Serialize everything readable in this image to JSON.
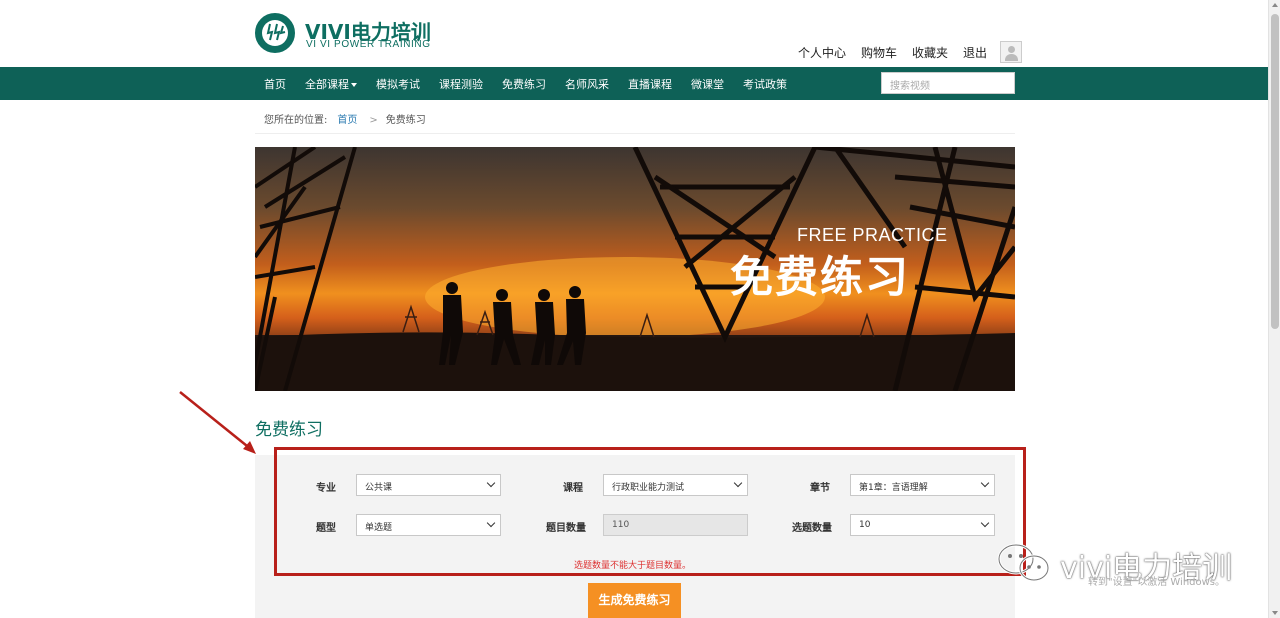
{
  "brand": {
    "title": "VIVI电力培训",
    "subtitle": "VI VI POWER TRAINING",
    "color": "#0e6e61"
  },
  "user_links": [
    "个人中心",
    "购物车",
    "收藏夹",
    "退出"
  ],
  "nav": {
    "items": [
      "首页",
      "全部课程",
      "模拟考试",
      "课程测验",
      "免费练习",
      "名师风采",
      "直播课程",
      "微课堂",
      "考试政策"
    ],
    "search_placeholder": "搜索视频",
    "color": "#0e6157"
  },
  "breadcrumb": {
    "prefix": "您所在的位置:",
    "home": "首页",
    "separator": ">",
    "current": "免费练习"
  },
  "banner": {
    "english": "FREE PRACTICE",
    "chinese": "免费练习"
  },
  "section": {
    "title": "免费练习"
  },
  "form": {
    "major": {
      "label": "专业",
      "value": "公共课"
    },
    "course": {
      "label": "课程",
      "value": "行政职业能力测试"
    },
    "chapter": {
      "label": "章节",
      "value": "第1章：言语理解"
    },
    "type": {
      "label": "题型",
      "value": "单选题"
    },
    "total": {
      "label": "题目数量",
      "value": "110"
    },
    "select_count": {
      "label": "选题数量",
      "value": "10"
    },
    "warning": "选题数量不能大于题目数量。",
    "submit": "生成免费练习"
  },
  "watermark": {
    "text": "vivi电力培训",
    "activate": "转到\"设置\"以激活 Windows。"
  },
  "accent_colors": {
    "red_annotation": "#b8201a",
    "button": "#f59023"
  }
}
